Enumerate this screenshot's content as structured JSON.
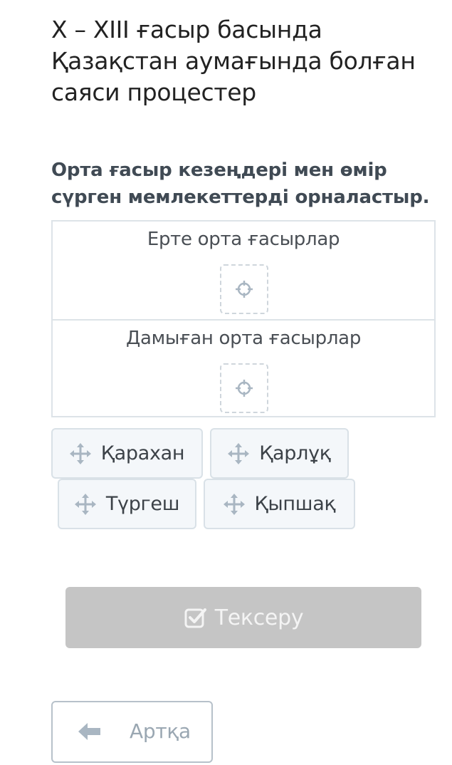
{
  "header": {
    "title": "X – XIII ғасыр басында Қазақстан аумағында болған саяси процестер"
  },
  "question": {
    "text": "Орта ғасыр кезеңдері мен өмір сүрген мемлекеттерді орналастыр."
  },
  "drop_zones": [
    {
      "label": "Ерте орта ғасырлар"
    },
    {
      "label": "Дамыған орта ғасырлар"
    }
  ],
  "drag_items": [
    {
      "label": "Қарахан"
    },
    {
      "label": "Қарлұқ"
    },
    {
      "label": "Түргеш"
    },
    {
      "label": "Қыпшақ"
    }
  ],
  "actions": {
    "check_label": "Тексеру",
    "back_label": "Артқа"
  },
  "icons": {
    "drop_slot": "crosshair-target-icon",
    "drag_handle": "move-arrows-icon",
    "check": "checkbox-check-icon",
    "back": "arrow-left-icon"
  },
  "colors": {
    "check_button_disabled": "#c5c5c5",
    "chip_background": "#f4f7fa",
    "zone_border": "#dde3e8",
    "icon_muted": "#a9b6c2"
  }
}
